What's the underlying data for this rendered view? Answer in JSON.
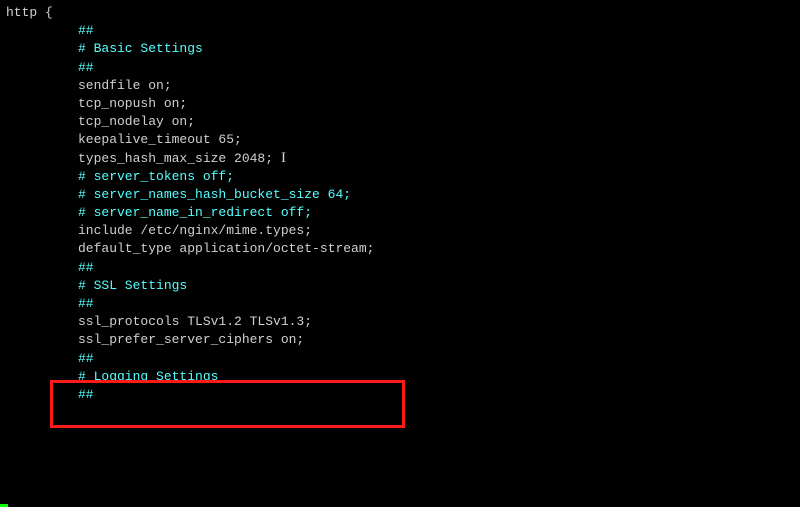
{
  "lines": {
    "l0": "http {",
    "l1": "",
    "l2": "##",
    "l3": "# Basic Settings",
    "l4": "##",
    "l5": "",
    "l6": "sendfile on;",
    "l7": "tcp_nopush on;",
    "l8": "tcp_nodelay on;",
    "l9": "keepalive_timeout 65;",
    "l10": "types_hash_max_size 2048;",
    "l11": "# server_tokens off;",
    "l12": "",
    "l13": "# server_names_hash_bucket_size 64;",
    "l14": "# server_name_in_redirect off;",
    "l15": "",
    "l16": "include /etc/nginx/mime.types;",
    "l17": "default_type application/octet-stream;",
    "l18": "",
    "l19": "##",
    "l20": "# SSL Settings",
    "l21": "##",
    "l22": "",
    "l23": "ssl_protocols TLSv1.2 TLSv1.3;",
    "l24": "ssl_prefer_server_ciphers on;",
    "l25": "",
    "l26": "##",
    "l27": "# Logging Settings",
    "l28": "##"
  }
}
